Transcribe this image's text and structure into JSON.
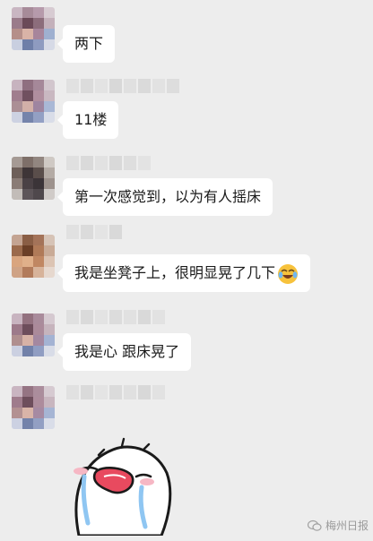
{
  "messages": [
    {
      "id": "m1",
      "text": "两下",
      "has_name": false
    },
    {
      "id": "m2",
      "text": "11楼",
      "has_name": true
    },
    {
      "id": "m3",
      "text": "第一次感觉到，以为有人摇床",
      "has_name": true
    },
    {
      "id": "m4",
      "text": "我是坐凳子上，很明显晃了几下",
      "has_name": true,
      "trailing_emoji": "laughing-crying-emoji-icon"
    },
    {
      "id": "m5",
      "text": "我是心 跟床晃了",
      "has_name": true
    },
    {
      "id": "m6",
      "text": "",
      "has_name": true,
      "sticker": "crying-sticker"
    }
  ],
  "watermark": {
    "text": "梅州日报",
    "icon": "wechat-official-icon"
  },
  "colors": {
    "background": "#ededed",
    "bubble": "#ffffff",
    "text": "#1a1a1a",
    "watermark": "#9a9a9a"
  }
}
